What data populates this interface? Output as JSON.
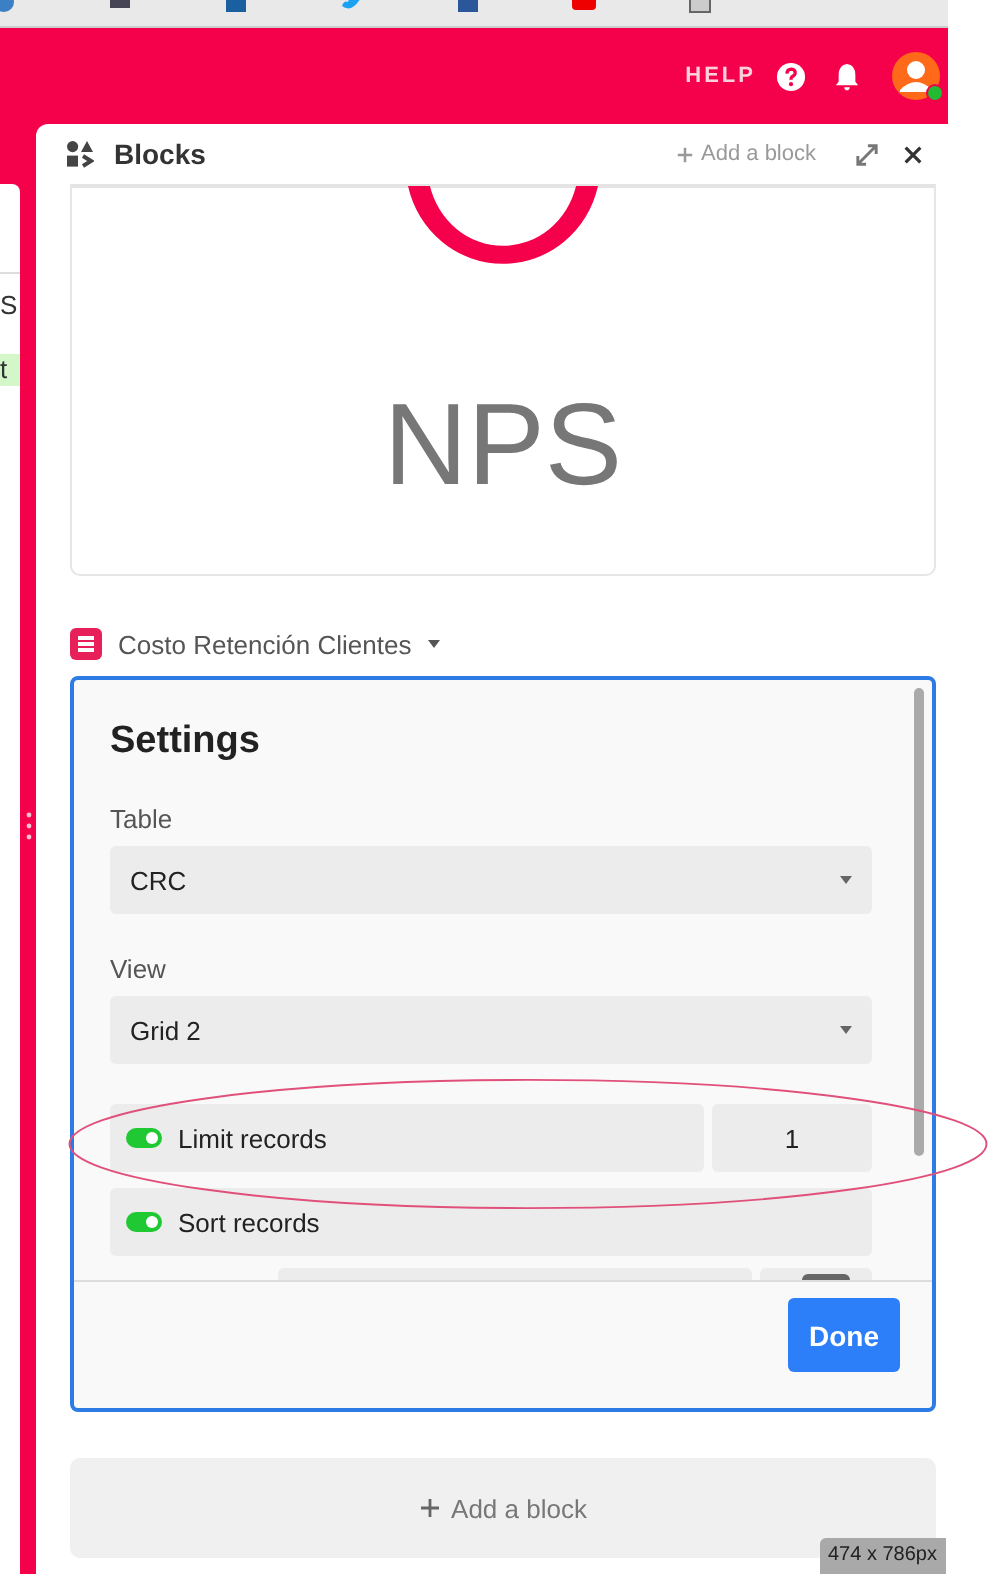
{
  "bookmarks": [
    {
      "kind": "globe"
    },
    {
      "kind": "monitor"
    },
    {
      "kind": "square"
    },
    {
      "kind": "bird"
    },
    {
      "kind": "doc"
    },
    {
      "kind": "play"
    },
    {
      "kind": "folder"
    }
  ],
  "header": {
    "help": "HELP",
    "user_online": true
  },
  "left_cells": [
    {
      "text": "S",
      "highlight": false
    },
    {
      "text": "t",
      "highlight": true
    }
  ],
  "panel": {
    "title": "Blocks",
    "add_label": "Add a block",
    "nps_card": {
      "label": "NPS"
    },
    "block_name": "Costo Retención Clientes",
    "settings": {
      "title": "Settings",
      "fields": [
        {
          "label": "Table",
          "value": "CRC"
        },
        {
          "label": "View",
          "value": "Grid 2"
        }
      ],
      "toggles": [
        {
          "label": "Limit records",
          "on": true,
          "value": "1"
        },
        {
          "label": "Sort records",
          "on": true
        }
      ],
      "done": "Done"
    },
    "add_block": "Add a block"
  },
  "size_badge": "474 x 786px"
}
